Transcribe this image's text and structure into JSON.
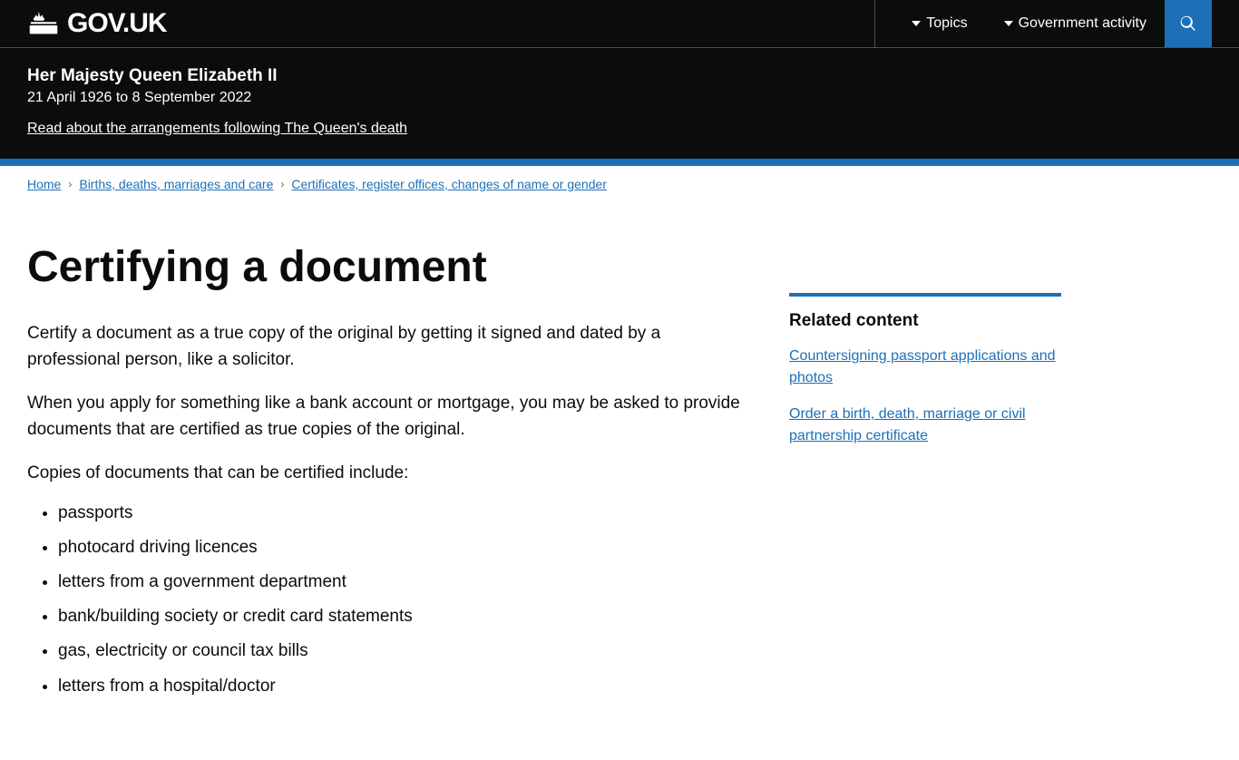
{
  "header": {
    "logo_text": "GOV.UK",
    "topics_label": "Topics",
    "govt_activity_label": "Government activity",
    "search_aria": "Search GOV.UK"
  },
  "memorial": {
    "name": "Her Majesty Queen Elizabeth II",
    "dates": "21 April 1926 to 8 September 2022",
    "link_text": "Read about the arrangements following The Queen's death"
  },
  "breadcrumb": {
    "home": "Home",
    "category": "Births, deaths, marriages and care",
    "subcategory": "Certificates, register offices, changes of name or gender"
  },
  "page": {
    "title": "Certifying a document",
    "intro": "Certify a document as a true copy of the original by getting it signed and dated by a professional person, like a solicitor.",
    "body": "When you apply for something like a bank account or mortgage, you may be asked to provide documents that are certified as true copies of the original.",
    "list_intro": "Copies of documents that can be certified include:",
    "list_items": [
      "passports",
      "photocard driving licences",
      "letters from a government department",
      "bank/building society or credit card statements",
      "gas, electricity or council tax bills",
      "letters from a hospital/doctor"
    ]
  },
  "sidebar": {
    "related_title": "Related content",
    "links": [
      {
        "text": "Countersigning passport applications and photos",
        "href": "#"
      },
      {
        "text": "Order a birth, death, marriage or civil partnership certificate",
        "href": "#"
      }
    ]
  }
}
